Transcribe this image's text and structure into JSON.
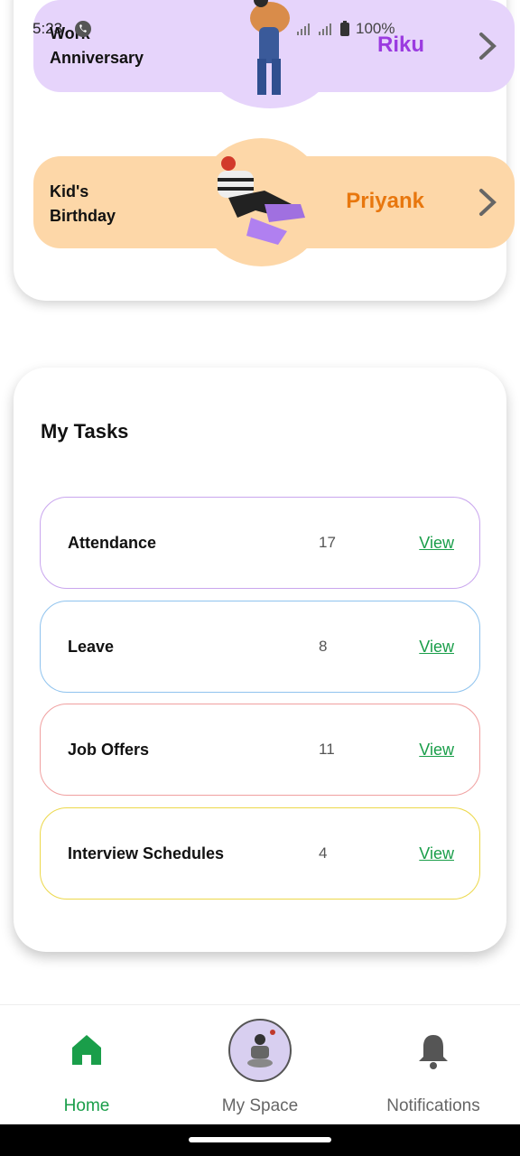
{
  "status_bar": {
    "time": "5:23",
    "battery": "100%"
  },
  "events": [
    {
      "label": "Work\nAnniversary",
      "person": "Riku",
      "bg": "#e6d4fb",
      "accent": "#9b3be0"
    },
    {
      "label": "Kid's\nBirthday",
      "person": "Priyank",
      "bg": "#fdd7a8",
      "accent": "#e8770e"
    }
  ],
  "tasks": {
    "title": "My Tasks",
    "items": [
      {
        "name": "Attendance",
        "count": "17",
        "action": "View",
        "border": "#c9a6ee"
      },
      {
        "name": "Leave",
        "count": "8",
        "action": "View",
        "border": "#8fc3ee"
      },
      {
        "name": "Job Offers",
        "count": "11",
        "action": "View",
        "border": "#f0a0a0"
      },
      {
        "name": "Interview Schedules",
        "count": "4",
        "action": "View",
        "border": "#ecd84a"
      }
    ]
  },
  "nav": {
    "home": "Home",
    "space": "My Space",
    "notifications": "Notifications",
    "active_color": "#1a9e4a"
  },
  "icons": {
    "home": "home-icon",
    "space": "avatar-icon",
    "notifications": "bell-icon",
    "chevron": "chevron-right-icon"
  }
}
